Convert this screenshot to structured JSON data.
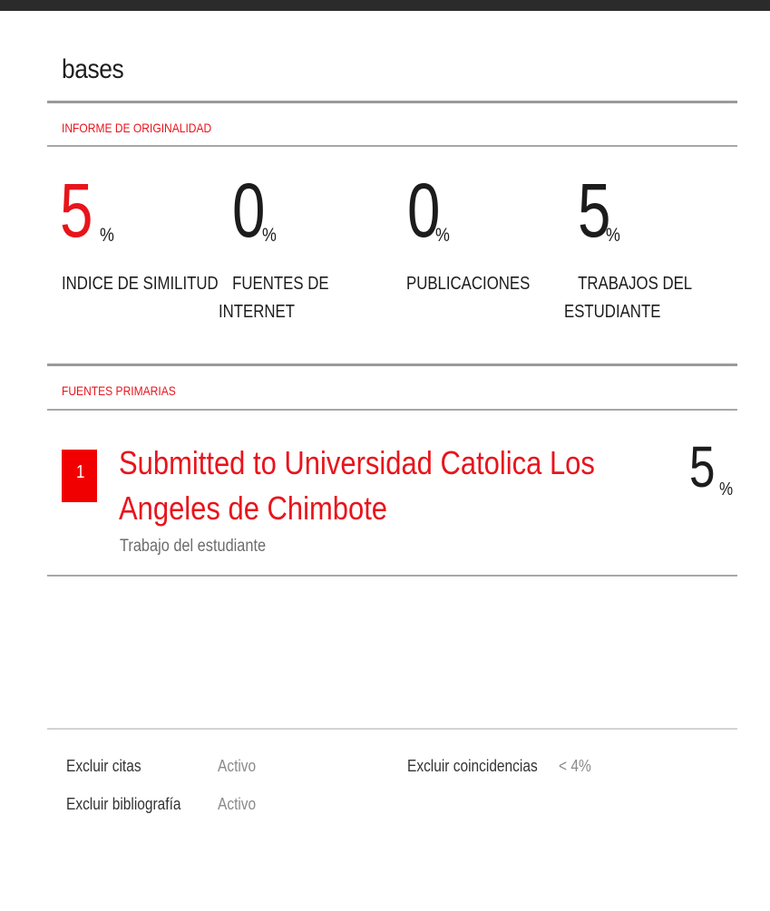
{
  "document": {
    "title": "bases"
  },
  "report": {
    "section_label": "INFORME DE ORIGINALIDAD",
    "percent_sign": "%",
    "stats": [
      {
        "value": "5",
        "caption_line1": "INDICE DE SIMILITUD",
        "caption_line2": ""
      },
      {
        "value": "0",
        "caption_line1": "FUENTES DE",
        "caption_line2": "INTERNET"
      },
      {
        "value": "0",
        "caption_line1": "PUBLICACIONES",
        "caption_line2": ""
      },
      {
        "value": "5",
        "caption_line1": "TRABAJOS DEL",
        "caption_line2": "ESTUDIANTE"
      }
    ]
  },
  "sources": {
    "section_label": "FUENTES PRIMARIAS",
    "items": [
      {
        "rank": "1",
        "title": "Submitted to Universidad Catolica Los Angeles de Chimbote",
        "type": "Trabajo del estudiante",
        "percent": "5",
        "percent_sign": "%"
      }
    ]
  },
  "footer": {
    "exclude_quotes_label": "Excluir citas",
    "exclude_quotes_value": "Activo",
    "exclude_bibliography_label": "Excluir bibliografía",
    "exclude_bibliography_value": "Activo",
    "exclude_matches_label": "Excluir coincidencias",
    "exclude_matches_value": "< 4%"
  },
  "colors": {
    "accent": "#e8141b",
    "badge": "#f00000",
    "topbar": "#2b2b2b"
  }
}
